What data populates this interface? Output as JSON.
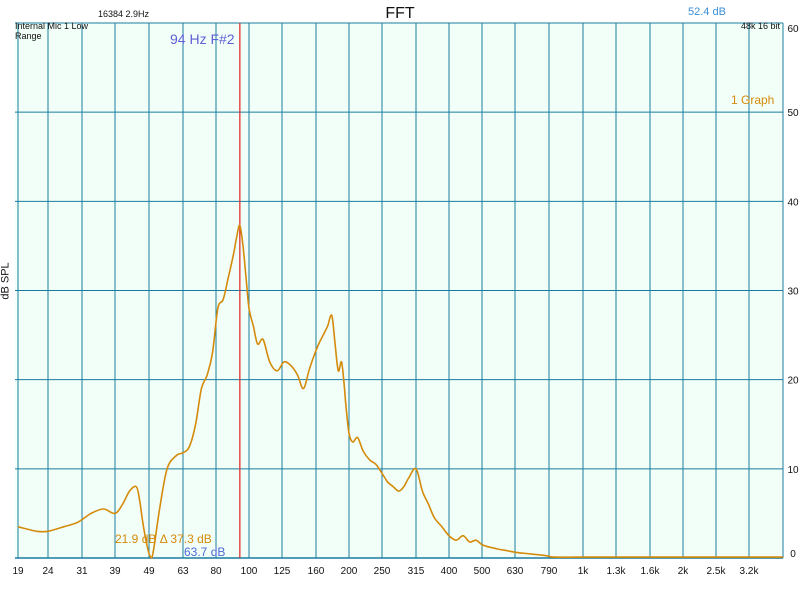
{
  "header": {
    "title": "FFT",
    "fft_size": "16384  2.9Hz",
    "source_line1": "Internal Mic 1 Low",
    "source_line2": "Range",
    "level": "52.4 dB",
    "format": "48k 16 bit",
    "graph_label": "1 Graph"
  },
  "cursor": {
    "label": "94 Hz F#2",
    "freq": 94
  },
  "readouts": {
    "line1": "21.9 dB Δ 37.3 dB",
    "line2": "63.7 dB"
  },
  "colors": {
    "grid": "#1a7ca0",
    "background": "#f2fff8",
    "trace": "#d48a0a",
    "cursor": "#e03030",
    "accent": "#3a8ed8",
    "cursor_label": "#5f5fd6"
  },
  "chart_data": {
    "type": "line",
    "title": "FFT",
    "xlabel": "",
    "ylabel": "dB SPL",
    "x_scale": "log",
    "xlim": [
      19,
      5000
    ],
    "ylim": [
      0,
      60
    ],
    "x_ticks": [
      19,
      24,
      31,
      39,
      49,
      63,
      80,
      100,
      125,
      160,
      200,
      250,
      315,
      400,
      500,
      630,
      790,
      1000,
      1300,
      1600,
      2000,
      2500,
      3200
    ],
    "x_tick_labels": [
      "19",
      "24",
      "31",
      "39",
      "49",
      "63",
      "80",
      "100",
      "125",
      "160",
      "200",
      "250",
      "315",
      "400",
      "500",
      "630",
      "790",
      "1k",
      "1.3k",
      "1.6k",
      "2k",
      "2.5k",
      "3.2k"
    ],
    "y_ticks": [
      0,
      10,
      20,
      30,
      40,
      50,
      60
    ],
    "grid": true,
    "series": [
      {
        "name": "",
        "x": [
          19,
          22,
          24,
          27,
          30,
          33,
          36,
          39,
          41,
          43,
          45,
          46,
          47,
          48,
          49,
          50,
          51,
          53,
          56,
          60,
          63,
          66,
          69,
          72,
          75,
          78,
          81,
          84,
          87,
          90,
          92,
          94,
          96,
          98,
          100,
          103,
          106,
          110,
          115,
          121,
          127,
          134,
          140,
          146,
          152,
          157,
          163,
          168,
          173,
          178,
          182,
          186,
          190,
          193,
          196,
          200,
          205,
          212,
          220,
          230,
          240,
          250,
          260,
          270,
          280,
          290,
          300,
          315,
          330,
          345,
          360,
          380,
          400,
          420,
          440,
          460,
          480,
          500,
          530,
          560,
          600,
          640,
          680,
          720,
          760,
          790,
          820,
          1000,
          1500,
          2000,
          3000,
          5000
        ],
        "y": [
          3.5,
          3.0,
          3.0,
          3.5,
          4.0,
          5.0,
          5.5,
          5.0,
          6.0,
          7.5,
          8.0,
          6.5,
          4.0,
          2.0,
          0.5,
          0.0,
          1.5,
          5.5,
          10.0,
          11.5,
          11.8,
          12.5,
          15.0,
          19.0,
          20.5,
          23.0,
          28.0,
          29.0,
          31.5,
          34.0,
          36.0,
          37.3,
          35.0,
          31.5,
          28.0,
          26.0,
          24.0,
          24.5,
          22.0,
          21.0,
          22.0,
          21.5,
          20.5,
          19.0,
          21.0,
          22.5,
          24.0,
          25.0,
          26.0,
          27.2,
          24.0,
          21.0,
          22.0,
          20.0,
          17.0,
          14.0,
          13.0,
          13.5,
          12.0,
          11.0,
          10.5,
          9.5,
          8.5,
          8.0,
          7.5,
          8.0,
          9.0,
          10.0,
          7.5,
          6.0,
          4.5,
          3.5,
          2.5,
          2.0,
          2.5,
          1.8,
          2.0,
          1.5,
          1.2,
          1.0,
          0.8,
          0.6,
          0.5,
          0.4,
          0.3,
          0.2,
          0.1,
          0.1,
          0.1,
          0.1,
          0.1,
          0.1
        ]
      }
    ]
  }
}
